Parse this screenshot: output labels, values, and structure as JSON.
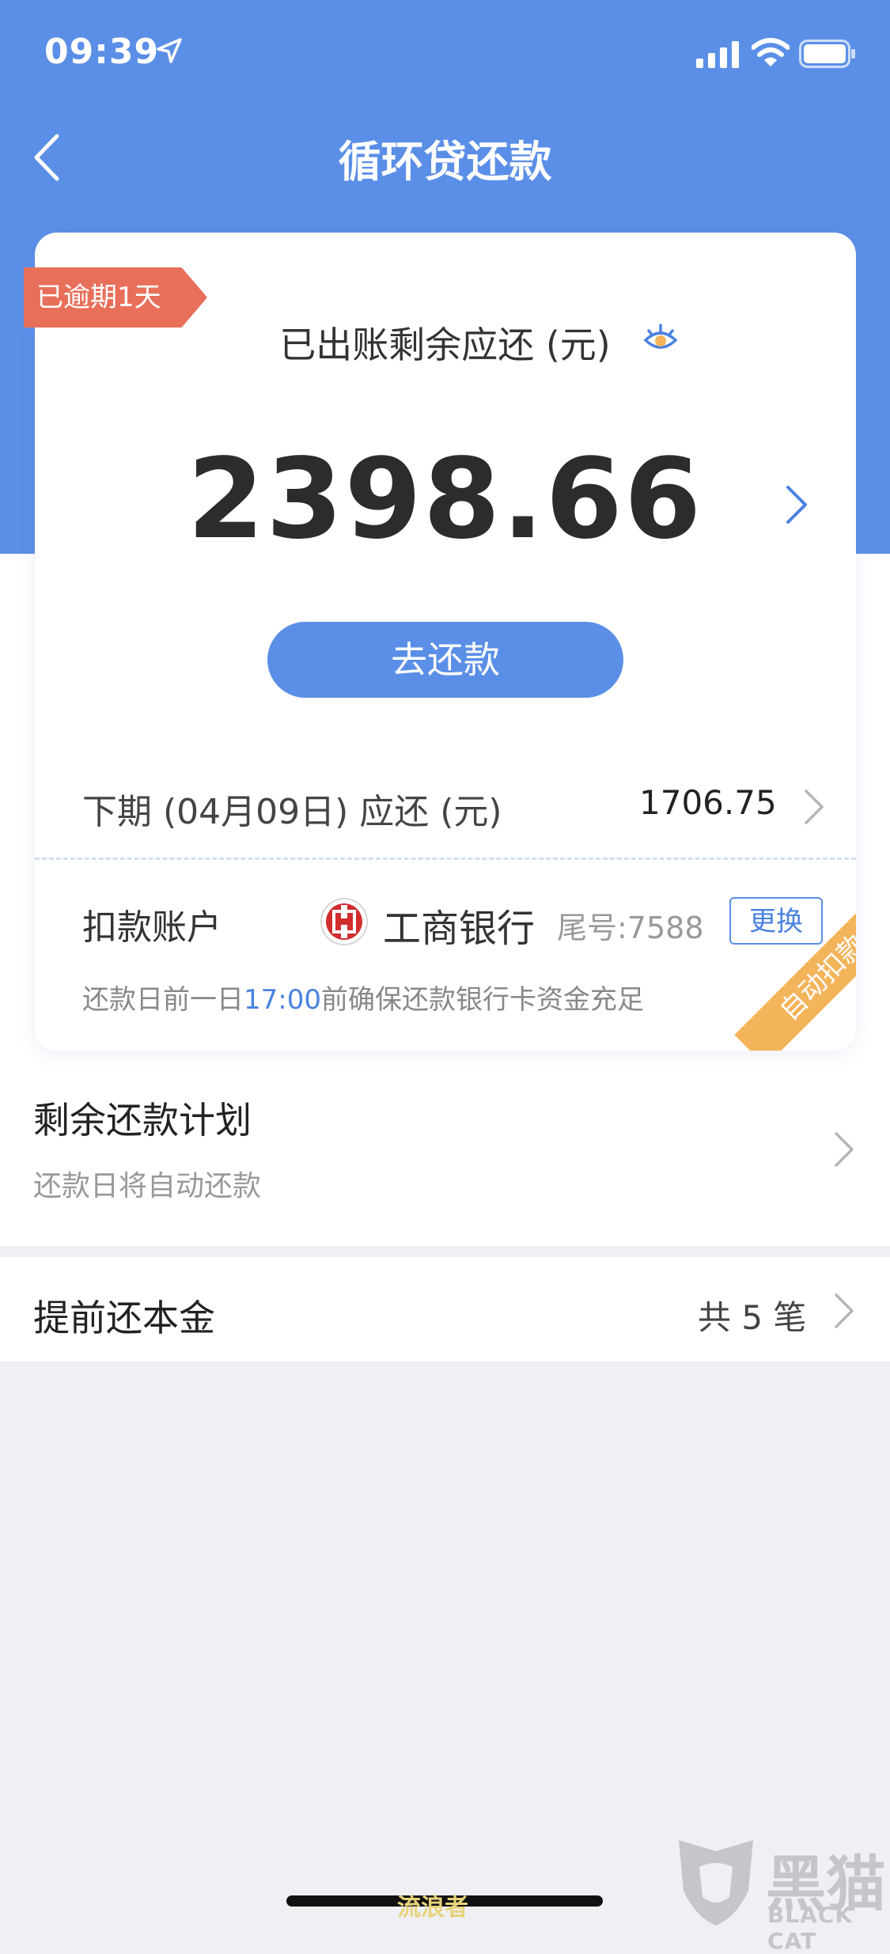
{
  "status_bar": {
    "time": "09:39"
  },
  "nav": {
    "title": "循环贷还款"
  },
  "bill": {
    "overdue_tag": "已逾期1天",
    "label": "已出账剩余应还 (元)",
    "amount": "2398.66",
    "repay_button": "去还款"
  },
  "next_period": {
    "label": "下期 (04月09日) 应还 (元)",
    "amount": "1706.75"
  },
  "deduct": {
    "label": "扣款账户",
    "bank_name": "工商银行",
    "card_tail": "尾号:7588",
    "change_button": "更换",
    "note_prefix": "还款日前一日",
    "note_time": "17:00",
    "note_suffix": "前确保还款银行卡资金充足",
    "auto_ribbon": "自动扣款"
  },
  "plan": {
    "title": "剩余还款计划",
    "subtitle": "还款日将自动还款"
  },
  "prepay": {
    "title": "提前还本金",
    "count": "共 5 笔"
  },
  "watermark": {
    "cn": "黑猫",
    "en": "BLACK CAT",
    "small": "流浪者"
  },
  "colors": {
    "primary": "#5b8fe7",
    "overdue": "#e8705a",
    "ribbon": "#f3b45a"
  },
  "icons": [
    "location-arrow-icon",
    "signal-icon",
    "wifi-icon",
    "battery-icon",
    "back-icon",
    "eye-icon",
    "chevron-right-icon",
    "icbc-logo-icon"
  ]
}
